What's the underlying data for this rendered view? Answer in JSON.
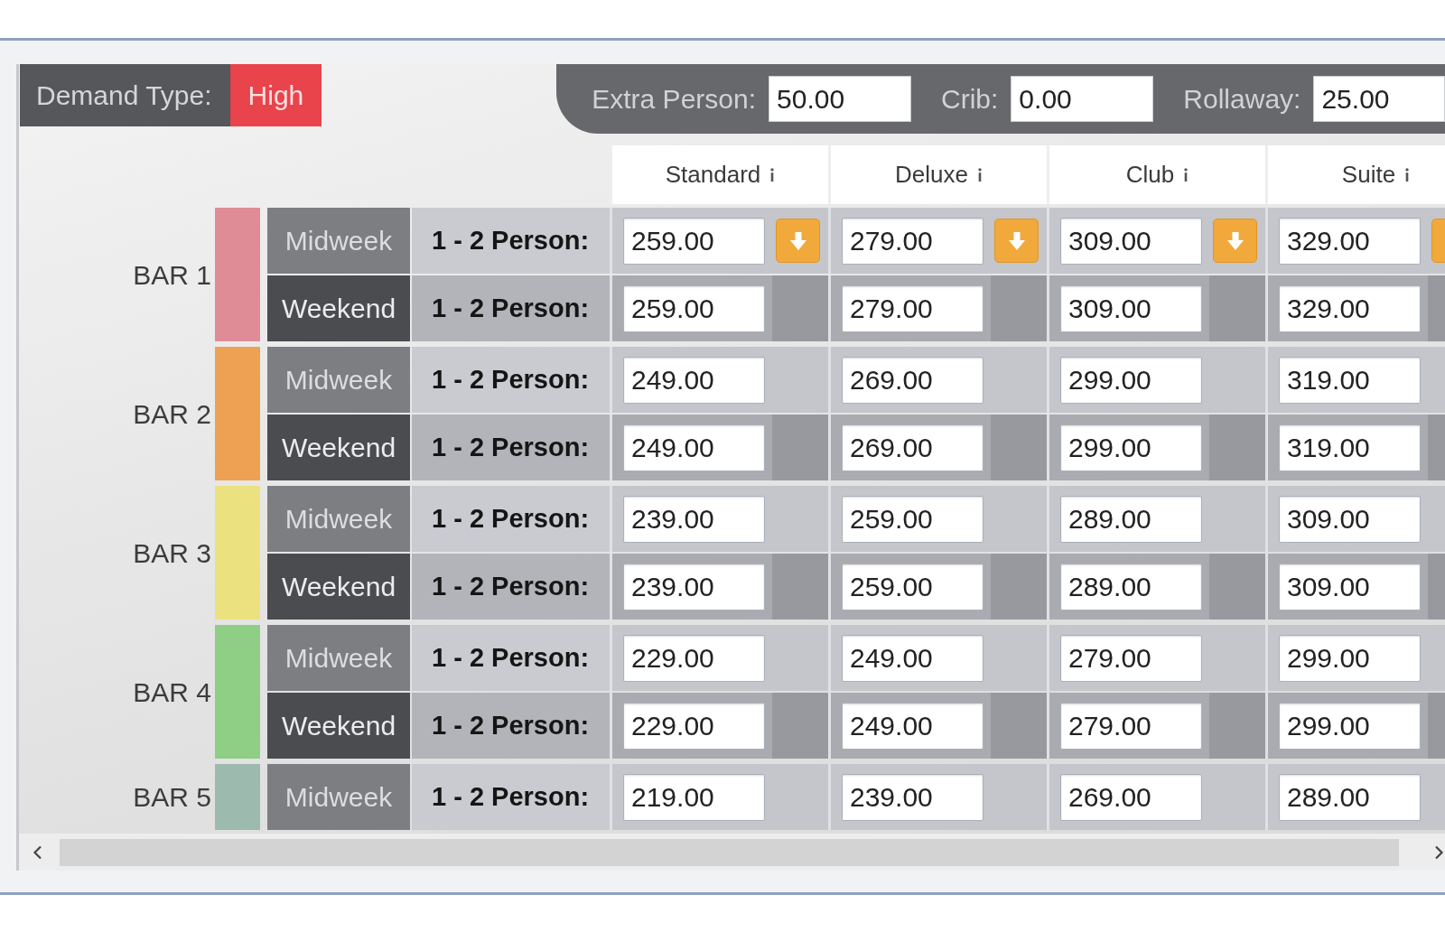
{
  "demand": {
    "label": "Demand Type:",
    "value": "High"
  },
  "extras": [
    {
      "label": "Extra Person:",
      "value": "50.00"
    },
    {
      "label": "Crib:",
      "value": "0.00"
    },
    {
      "label": "Rollaway:",
      "value": "25.00"
    }
  ],
  "columns": [
    "Standard",
    "Deluxe",
    "Club",
    "Suite"
  ],
  "bars": [
    {
      "label": "BAR 1",
      "color": "#e08c96",
      "rows": [
        {
          "kind": "midweek",
          "period": "Midweek",
          "occupancy": "1 - 2 Person:",
          "fill_down": true,
          "rates": [
            "259.00",
            "279.00",
            "309.00",
            "329.00"
          ]
        },
        {
          "kind": "weekend",
          "period": "Weekend",
          "occupancy": "1 - 2 Person:",
          "fill_down": false,
          "rates": [
            "259.00",
            "279.00",
            "309.00",
            "329.00"
          ]
        }
      ]
    },
    {
      "label": "BAR 2",
      "color": "#eea152",
      "rows": [
        {
          "kind": "midweek",
          "period": "Midweek",
          "occupancy": "1 - 2 Person:",
          "fill_down": false,
          "rates": [
            "249.00",
            "269.00",
            "299.00",
            "319.00"
          ]
        },
        {
          "kind": "weekend",
          "period": "Weekend",
          "occupancy": "1 - 2 Person:",
          "fill_down": false,
          "rates": [
            "249.00",
            "269.00",
            "299.00",
            "319.00"
          ]
        }
      ]
    },
    {
      "label": "BAR 3",
      "color": "#ece17f",
      "rows": [
        {
          "kind": "midweek",
          "period": "Midweek",
          "occupancy": "1 - 2 Person:",
          "fill_down": false,
          "rates": [
            "239.00",
            "259.00",
            "289.00",
            "309.00"
          ]
        },
        {
          "kind": "weekend",
          "period": "Weekend",
          "occupancy": "1 - 2 Person:",
          "fill_down": false,
          "rates": [
            "239.00",
            "259.00",
            "289.00",
            "309.00"
          ]
        }
      ]
    },
    {
      "label": "BAR 4",
      "color": "#8fce85",
      "rows": [
        {
          "kind": "midweek",
          "period": "Midweek",
          "occupancy": "1 - 2 Person:",
          "fill_down": false,
          "rates": [
            "229.00",
            "249.00",
            "279.00",
            "299.00"
          ]
        },
        {
          "kind": "weekend",
          "period": "Weekend",
          "occupancy": "1 - 2 Person:",
          "fill_down": false,
          "rates": [
            "229.00",
            "249.00",
            "279.00",
            "299.00"
          ]
        }
      ]
    },
    {
      "label": "BAR 5",
      "color": "#9dbaae",
      "rows": [
        {
          "kind": "midweek",
          "period": "Midweek",
          "occupancy": "1 - 2 Person:",
          "fill_down": false,
          "rates": [
            "219.00",
            "239.00",
            "269.00",
            "289.00"
          ]
        }
      ]
    }
  ]
}
